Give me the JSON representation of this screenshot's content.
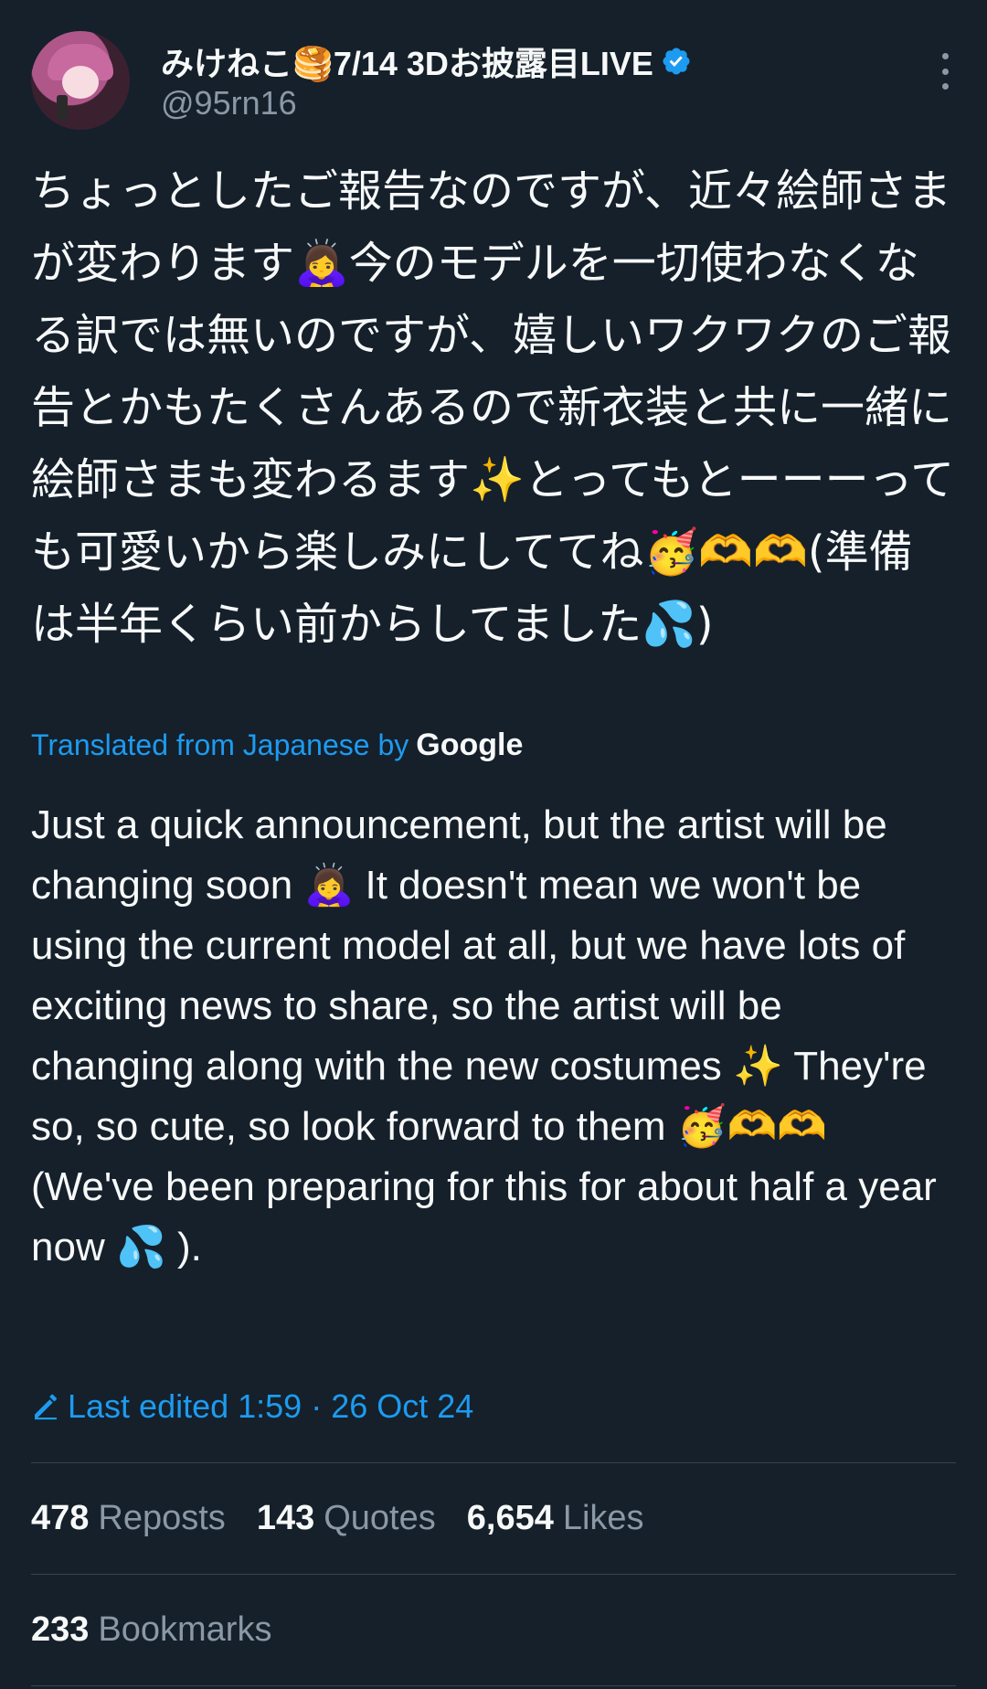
{
  "tweet": {
    "display_name": "みけねこ🥞7/14 3Dお披露目LIVE",
    "handle": "@95rn16",
    "icons": {
      "verified": "verified-badge-icon",
      "more": "more-options-icon",
      "avatar": "profile-avatar"
    },
    "text_jp": "ちょっとしたご報告なのですが、近々絵師さまが変わります🙇‍♀️今のモデルを一切使わなくなる訳では無いのですが、嬉しいワクワクのご報告とかもたくさんあるので新衣装と共に一緒に絵師さまも変わるます✨とってもとーーーっても可愛いから楽しみにしててね🥳🫶🫶(準備は半年くらい前からしてました💦)",
    "translated_label": "Translated from Japanese by",
    "translated_provider": "Google",
    "text_en": "Just a quick announcement, but the artist will be changing soon 🙇‍♀️ It doesn't mean we won't be using the current model at all, but we have lots of exciting news to share, so the artist will be changing along with the new costumes ✨ They're so, so cute, so look forward to them 🥳🫶🫶 (We've been preparing for this for about half a year now 💦 ).",
    "last_edited": "Last edited 1:59 · 26 Oct 24",
    "stats": {
      "reposts_count": "478",
      "reposts_label": "Reposts",
      "quotes_count": "143",
      "quotes_label": "Quotes",
      "likes_count": "6,654",
      "likes_label": "Likes",
      "bookmarks_count": "233",
      "bookmarks_label": "Bookmarks"
    },
    "colors": {
      "background": "#15202b",
      "accent": "#1d9bf0",
      "secondary_text": "#8b98a5",
      "divider": "#38444d"
    }
  }
}
